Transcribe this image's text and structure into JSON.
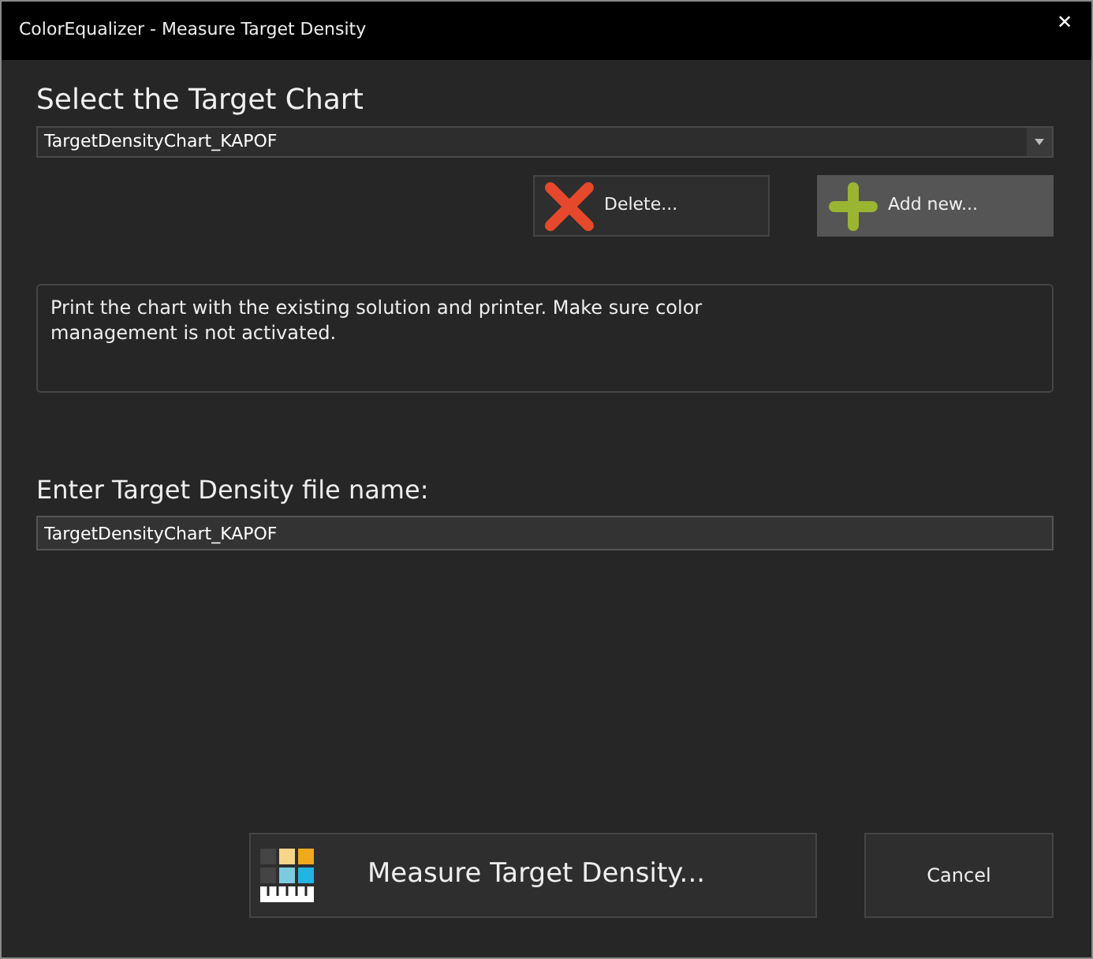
{
  "window": {
    "title": "ColorEqualizer - Measure Target Density",
    "close": "✕"
  },
  "chart_section": {
    "heading": "Select the Target Chart",
    "dropdown": {
      "value": "TargetDensityChart_KAPOF"
    }
  },
  "chart_buttons": [
    {
      "label": "Delete...",
      "kind": "delete",
      "hovered": false
    },
    {
      "label": "Add new...",
      "kind": "add",
      "hovered": true
    }
  ],
  "info_text": "Print the chart with the existing solution and printer. Make sure color management is not activated.",
  "file_section": {
    "label": "Enter Target Density file name:",
    "field": {
      "value": "TargetDensityChart_KAPOF"
    }
  },
  "footer_buttons": [
    {
      "label": "Measure Target Density...",
      "kind": "measure"
    },
    {
      "label": "Cancel",
      "kind": "plain"
    }
  ]
}
